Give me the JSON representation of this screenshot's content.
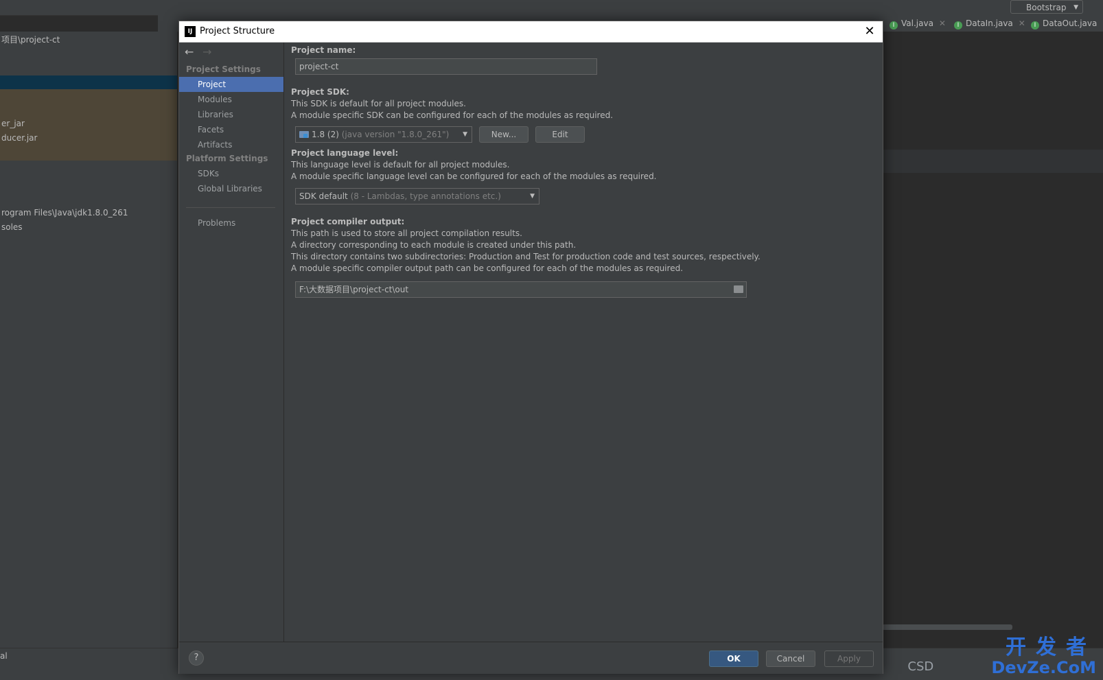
{
  "ide": {
    "left_rows": [
      "项目\\project-ct",
      "er_jar",
      "ducer.jar",
      "rogram Files\\Java\\jdk1.8.0_261",
      "soles"
    ],
    "bottom_left": "al",
    "run_config": "Bootstrap",
    "tabs": [
      {
        "label": "Val.java"
      },
      {
        "label": "DataIn.java"
      },
      {
        "label": "DataOut.java"
      }
    ],
    "watermark": {
      "cn": "开发者",
      "en": "DevZe.CoM",
      "csdn": "CSD"
    }
  },
  "dialog": {
    "title": "Project Structure",
    "logo_text": "IJ",
    "close_glyph": "✕",
    "nav": {
      "back": "←",
      "forward": "→",
      "project_settings_header": "Project Settings",
      "project_settings_items": [
        "Project",
        "Modules",
        "Libraries",
        "Facets",
        "Artifacts"
      ],
      "platform_settings_header": "Platform Settings",
      "platform_settings_items": [
        "SDKs",
        "Global Libraries"
      ],
      "problems": "Problems",
      "active": "Project"
    },
    "project_name": {
      "label": "Project name:",
      "value": "project-ct"
    },
    "sdk": {
      "label": "Project SDK:",
      "desc1": "This SDK is default for all project modules.",
      "desc2": "A module specific SDK can be configured for each of the modules as required.",
      "selected": "1.8 (2)",
      "selected_detail": "(java version \"1.8.0_261\")",
      "new_button": "New...",
      "edit_button": "Edit"
    },
    "language_level": {
      "label": "Project language level:",
      "desc1": "This language level is default for all project modules.",
      "desc2": "A module specific language level can be configured for each of the modules as required.",
      "selected": "SDK default",
      "selected_detail": "(8 - Lambdas, type annotations etc.)"
    },
    "compiler_output": {
      "label": "Project compiler output:",
      "desc1": "This path is used to store all project compilation results.",
      "desc2": "A directory corresponding to each module is created under this path.",
      "desc3": "This directory contains two subdirectories: Production and Test for production code and test sources, respectively.",
      "desc4": "A module specific compiler output path can be configured for each of the modules as required.",
      "value": "F:\\大数据项目\\project-ct\\out"
    },
    "footer": {
      "help": "?",
      "ok": "OK",
      "cancel": "Cancel",
      "apply": "Apply"
    }
  },
  "colors": {
    "selection": "#4b6eaf",
    "primary_button": "#365880",
    "background": "#3c3f41"
  }
}
